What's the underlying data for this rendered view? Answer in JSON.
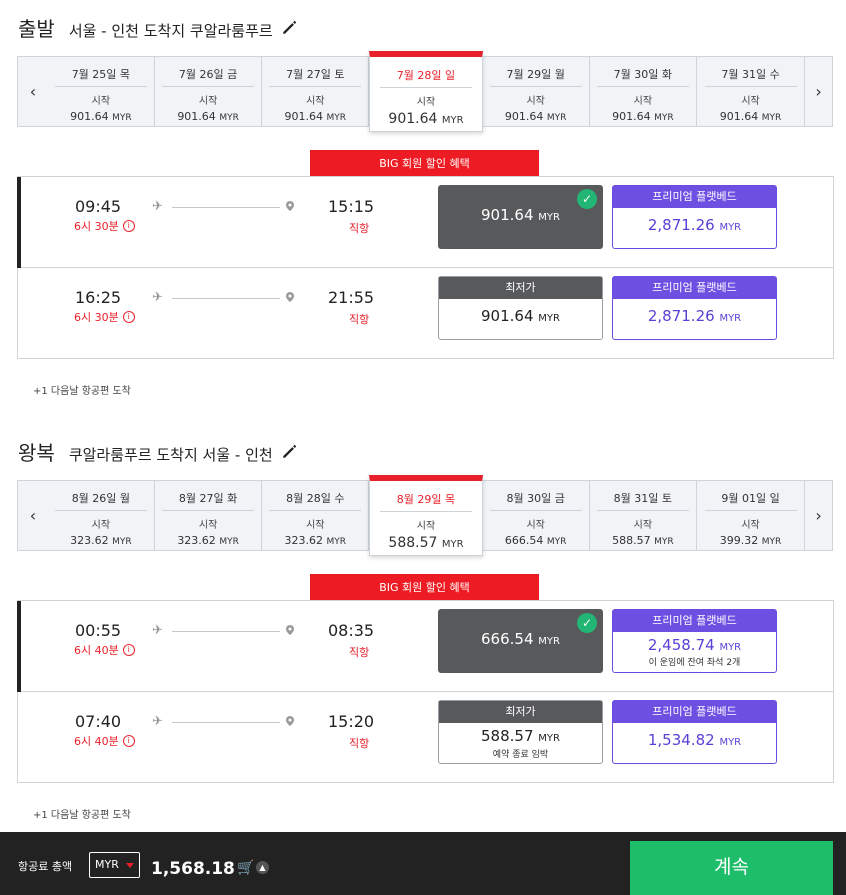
{
  "outbound": {
    "label": "출발",
    "route": "서울 - 인천 도착지 쿠알라룸푸르",
    "dates": [
      {
        "date": "7월 25일 목",
        "from": "시작",
        "price": "901.64",
        "cur": "MYR"
      },
      {
        "date": "7월 26일 금",
        "from": "시작",
        "price": "901.64",
        "cur": "MYR"
      },
      {
        "date": "7월 27일 토",
        "from": "시작",
        "price": "901.64",
        "cur": "MYR"
      },
      {
        "date": "7월 28일 일",
        "from": "시작",
        "price": "901.64",
        "cur": "MYR"
      },
      {
        "date": "7월 29일 월",
        "from": "시작",
        "price": "901.64",
        "cur": "MYR"
      },
      {
        "date": "7월 30일 화",
        "from": "시작",
        "price": "901.64",
        "cur": "MYR"
      },
      {
        "date": "7월 31일 수",
        "from": "시작",
        "price": "901.64",
        "cur": "MYR"
      }
    ],
    "promo": "BIG 회원 할인 혜택",
    "flights": [
      {
        "dep": "09:45",
        "arr": "15:15",
        "duration": "6시 30분",
        "type": "직항",
        "fare_price": "901.64",
        "fare_header": "",
        "fare_note": "",
        "prem_header": "프리미엄 플랫베드",
        "prem_price": "2,871.26",
        "prem_note": ""
      },
      {
        "dep": "16:25",
        "arr": "21:55",
        "duration": "6시 30분",
        "type": "직항",
        "fare_price": "901.64",
        "fare_header": "최저가",
        "fare_note": "",
        "prem_header": "프리미엄 플랫베드",
        "prem_price": "2,871.26",
        "prem_note": ""
      }
    ],
    "footnote": "+1 다음날 항공편 도착"
  },
  "return": {
    "label": "왕복",
    "route": "쿠알라룸푸르 도착지 서울 - 인천",
    "dates": [
      {
        "date": "8월 26일 월",
        "from": "시작",
        "price": "323.62",
        "cur": "MYR"
      },
      {
        "date": "8월 27일 화",
        "from": "시작",
        "price": "323.62",
        "cur": "MYR"
      },
      {
        "date": "8월 28일 수",
        "from": "시작",
        "price": "323.62",
        "cur": "MYR"
      },
      {
        "date": "8월 29일 목",
        "from": "시작",
        "price": "588.57",
        "cur": "MYR"
      },
      {
        "date": "8월 30일 금",
        "from": "시작",
        "price": "666.54",
        "cur": "MYR"
      },
      {
        "date": "8월 31일 토",
        "from": "시작",
        "price": "588.57",
        "cur": "MYR"
      },
      {
        "date": "9월 01일 일",
        "from": "시작",
        "price": "399.32",
        "cur": "MYR"
      }
    ],
    "promo": "BIG 회원 할인 혜택",
    "flights": [
      {
        "dep": "00:55",
        "arr": "08:35",
        "duration": "6시 40분",
        "type": "직항",
        "fare_price": "666.54",
        "fare_header": "",
        "fare_note": "",
        "prem_header": "프리미엄 플랫베드",
        "prem_price": "2,458.74",
        "prem_note": "이 운임에 잔여 좌석 2개"
      },
      {
        "dep": "07:40",
        "arr": "15:20",
        "duration": "6시 40분",
        "type": "직항",
        "fare_price": "588.57",
        "fare_header": "최저가",
        "fare_note": "예약 종료 임박",
        "prem_header": "프리미엄 플랫베드",
        "prem_price": "1,534.82",
        "prem_note": ""
      }
    ],
    "footnote": "+1 다음날 항공편 도착"
  },
  "currency_unit": "MYR",
  "footer": {
    "total_label": "항공료 총액",
    "currency": "MYR",
    "total": "1,568.18",
    "continue": "계속"
  },
  "colors": {
    "accent_red": "#ed1c24",
    "premium_purple": "#6d4fe1",
    "continue_green": "#1dbd6a",
    "selected_fare": "#58595b"
  }
}
